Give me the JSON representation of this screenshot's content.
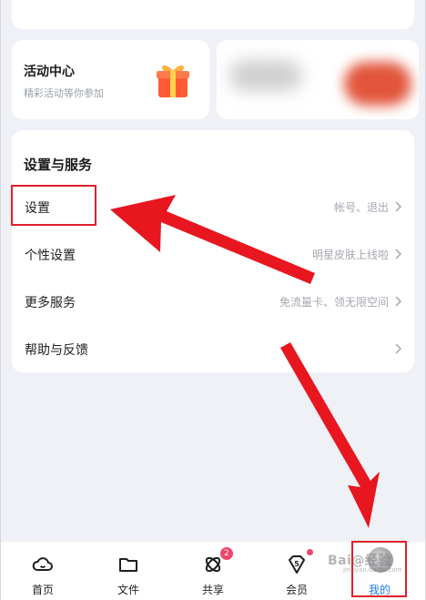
{
  "activity": {
    "title": "活动中心",
    "subtitle": "精彩活动等你参加",
    "icon": "gift-icon"
  },
  "services": {
    "title": "设置与服务",
    "rows": [
      {
        "label": "设置",
        "value": "帐号、退出"
      },
      {
        "label": "个性设置",
        "value": "明星皮肤上线啦"
      },
      {
        "label": "更多服务",
        "value": "免流量卡、领无限空间"
      },
      {
        "label": "帮助与反馈",
        "value": ""
      }
    ]
  },
  "tabbar": {
    "items": [
      {
        "label": "首页",
        "icon": "home-cloud-icon"
      },
      {
        "label": "文件",
        "icon": "folder-icon"
      },
      {
        "label": "共享",
        "icon": "share-orbit-icon",
        "badge": "2"
      },
      {
        "label": "会员",
        "icon": "vip-gem-icon",
        "dot": true
      },
      {
        "label": "我的",
        "icon": "avatar",
        "active": true
      }
    ]
  },
  "watermark": {
    "text": "Bai@经验",
    "sub": "jingyan.baidu.com"
  },
  "colors": {
    "accent": "#1e7cf2",
    "annotation_red": "#e0202b",
    "badge": "#f2456a"
  }
}
